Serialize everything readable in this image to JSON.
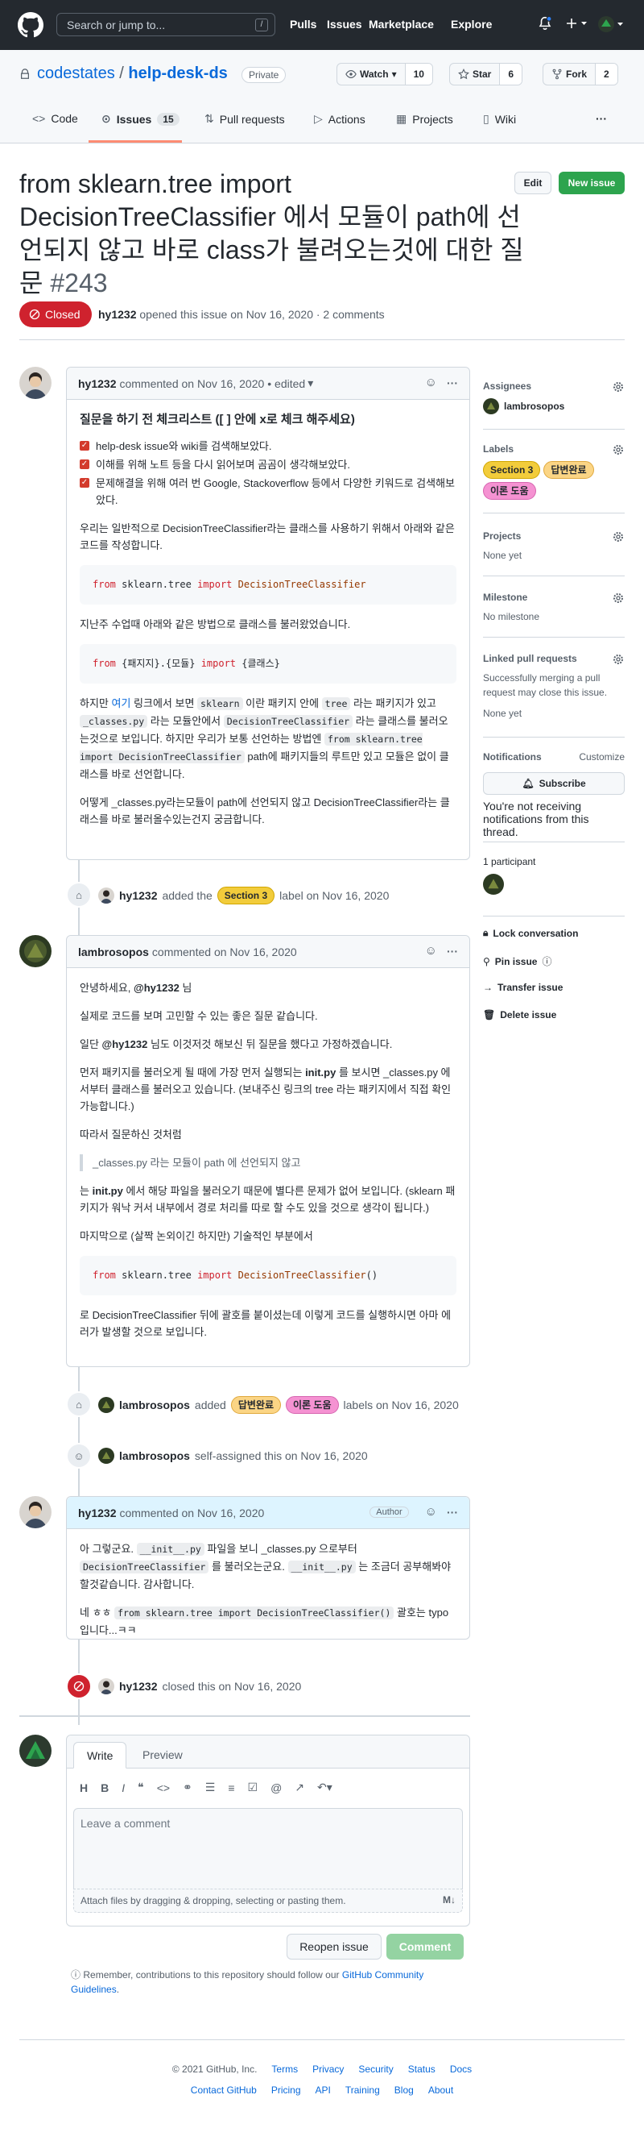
{
  "header": {
    "search_placeholder": "Search or jump to...",
    "slash_key": "/",
    "nav": [
      "Pulls",
      "Issues",
      "Marketplace",
      "Explore"
    ]
  },
  "repo": {
    "owner": "codestates",
    "separator": "/",
    "name": "help-desk-ds",
    "visibility": "Private",
    "watch_label": "Watch",
    "watch_count": "10",
    "star_label": "Star",
    "star_count": "6",
    "fork_label": "Fork",
    "fork_count": "2",
    "tabs": [
      {
        "label": "Code"
      },
      {
        "label": "Issues",
        "count": "15"
      },
      {
        "label": "Pull requests"
      },
      {
        "label": "Actions"
      },
      {
        "label": "Projects"
      },
      {
        "label": "Wiki"
      }
    ]
  },
  "issue": {
    "title": "from sklearn.tree import DecisionTreeClassifier 에서 모듈이 path에 선언되지 않고 바로 class가 불려오는것에 대한 질문",
    "number": "#243",
    "edit_label": "Edit",
    "new_issue_label": "New issue",
    "state": "Closed",
    "author": "hy1232",
    "opened_text": "opened this issue on Nov 16, 2020 · 2 comments"
  },
  "comments": [
    {
      "author": "hy1232",
      "meta": "commented on Nov 16, 2020",
      "edited": "• edited",
      "heading": "질문을 하기 전 체크리스트 ([ ] 안에 x로 체크 해주세요)",
      "tasks": [
        "help-desk issue와 wiki를 검색해보았다.",
        "이해를 위해 노트 등을 다시 읽어보며 곰곰이 생각해보았다.",
        "문제해결을 위해 여러 번 Google, Stackoverflow 등에서 다양한 키워드로 검색해보았다."
      ],
      "p1": "우리는 일반적으로 DecisionTreeClassifier라는 클래스를 사용하기 위해서 아래와 같은 코드를 작성합니다.",
      "code1_from": "from",
      "code1_mod": " sklearn.tree ",
      "code1_import": "import",
      "code1_cls": " DecisionTreeClassifier",
      "p2": "지난주 수업때 아래와 같은 방법으로 클래스를 불러왔었습니다.",
      "code2_from": "from",
      "code2_mod": " {패지지}.{모듈} ",
      "code2_import": "import",
      "code2_cls": " {클래스}",
      "p3_a": "하지만 ",
      "p3_link": "여기",
      "p3_b": " 링크에서 보면 ",
      "p3_c1": "sklearn",
      "p3_d": " 이란 패키지 안에 ",
      "p3_c2": "tree",
      "p3_e": " 라는 패키지가 있고 ",
      "p3_c3": "_classes.py",
      "p3_f": " 라는 모듈안에서 ",
      "p3_c4": "DecisionTreeClassifier",
      "p3_g": " 라는 클래스를 불러오는것으로 보입니다. 하지만 우리가 보통 선언하는 방법엔 ",
      "p3_c5": "from sklearn.tree import DecisionTreeClassifier",
      "p3_h": " path에 패키지들의 루트만 있고 모듈은 없이 클래스를 바로 선언합니다.",
      "p4": "어떻게 _classes.py라는모듈이 path에 선언되지 않고 DecisionTreeClassifier라는 클래스를 바로 불러올수있는건지 궁금합니다."
    },
    {
      "author": "lambrosopos",
      "meta": "commented on Nov 16, 2020",
      "p1_a": "안녕하세요, ",
      "p1_mention": "@hy1232",
      "p1_b": " 님",
      "p2": "실제로 코드를 보며 고민할 수 있는 좋은 질문 같습니다.",
      "p3_a": "일단 ",
      "p3_mention": "@hy1232",
      "p3_b": " 님도 이것저것 해보신 뒤 질문을 했다고 가정하겠습니다.",
      "p4_a": "먼저 패키지를 불러오게 될 때에 가장 먼저 실행되는 ",
      "p4_bold": "init.py",
      "p4_b": " 를 보시면 _classes.py 에서부터 클래스를 불러오고 있습니다. (보내주신 링크의 tree 라는 패키지에서 직접 확인 가능합니다.)",
      "p5": "따라서 질문하신 것처럼",
      "quote": "_classes.py 라는 모듈이 path 에 선언되지 않고",
      "p6_a": "는 ",
      "p6_bold": "init.py",
      "p6_b": " 에서 해당 파일을 불러오기 때문에 별다른 문제가 없어 보입니다. (sklearn 패키지가 워낙 커서 내부에서 경로 처리를 따로 할 수도 있을 것으로 생각이 됩니다.)",
      "p7": "마지막으로 (살짝 논외이긴 하지만) 기술적인 부분에서",
      "code_from": "from",
      "code_mod": " sklearn.tree ",
      "code_import": "import",
      "code_cls": " DecisionTreeClassifier",
      "code_paren": "()",
      "p8": "로 DecisionTreeClassifier 뒤에 괄호를 붙이셨는데 이렇게 코드를 실행하시면 아마 에러가 발생할 것으로 보입니다."
    },
    {
      "author": "hy1232",
      "meta": "commented on Nov 16, 2020",
      "badge": "Author",
      "p1_a": "아 그렇군요. ",
      "p1_c1": "__init__.py",
      "p1_b": " 파일을 보니 _classes.py 으로부터 ",
      "p1_c2": "DecisionTreeClassifier",
      "p1_c": " 를 불러오는군요. ",
      "p1_c3": "__init__.py",
      "p1_d": " 는 조금더 공부해봐야 할것같습니다. 감사합니다.",
      "p2_a": "네 ㅎㅎ ",
      "p2_code": "from sklearn.tree import DecisionTreeClassifier()",
      "p2_b": " 괄호는 typo 입니다...ㅋㅋ"
    }
  ],
  "events": {
    "label_added_user": "hy1232",
    "label_added_text": "added the",
    "label_added_label": "Section 3",
    "label_added_suffix": "label on Nov 16, 2020",
    "labels_added_user": "lambrosopos",
    "labels_added_text": "added",
    "labels_added_l1": "답변완료",
    "labels_added_l2": "이론 도움",
    "labels_added_suffix": "labels on Nov 16, 2020",
    "assigned_user": "lambrosopos",
    "assigned_text": "self-assigned this on Nov 16, 2020",
    "closed_user": "hy1232",
    "closed_text": "closed this on Nov 16, 2020"
  },
  "sidebar": {
    "assignees_title": "Assignees",
    "assignee": "lambrosopos",
    "labels_title": "Labels",
    "labels": [
      "Section 3",
      "답변완료",
      "이론 도움"
    ],
    "projects_title": "Projects",
    "projects_value": "None yet",
    "milestone_title": "Milestone",
    "milestone_value": "No milestone",
    "linked_title": "Linked pull requests",
    "linked_desc": "Successfully merging a pull request may close this issue.",
    "linked_value": "None yet",
    "notifications_title": "Notifications",
    "customize": "Customize",
    "subscribe": "Subscribe",
    "notif_desc": "You're not receiving notifications from this thread.",
    "participants": "1 participant",
    "lock": "Lock conversation",
    "pin": "Pin issue",
    "transfer": "Transfer issue",
    "delete": "Delete issue"
  },
  "new_comment": {
    "write_tab": "Write",
    "preview_tab": "Preview",
    "placeholder": "Leave a comment",
    "attach": "Attach files by dragging & dropping, selecting or pasting them.",
    "reopen": "Reopen issue",
    "comment": "Comment",
    "remember_a": "Remember, contributions to this repository should follow our ",
    "remember_link": "GitHub Community Guidelines",
    "remember_b": "."
  },
  "footer": {
    "copyright": "© 2021 GitHub, Inc.",
    "row1": [
      "Terms",
      "Privacy",
      "Security",
      "Status",
      "Docs"
    ],
    "row2": [
      "Contact GitHub",
      "Pricing",
      "API",
      "Training",
      "Blog",
      "About"
    ]
  },
  "colors": {
    "closed_red": "#cf222e",
    "new_issue_green": "#2da44e",
    "label_section3": "#f2cc3b",
    "label_answered": "#fbd585",
    "label_help": "#f592d2"
  }
}
